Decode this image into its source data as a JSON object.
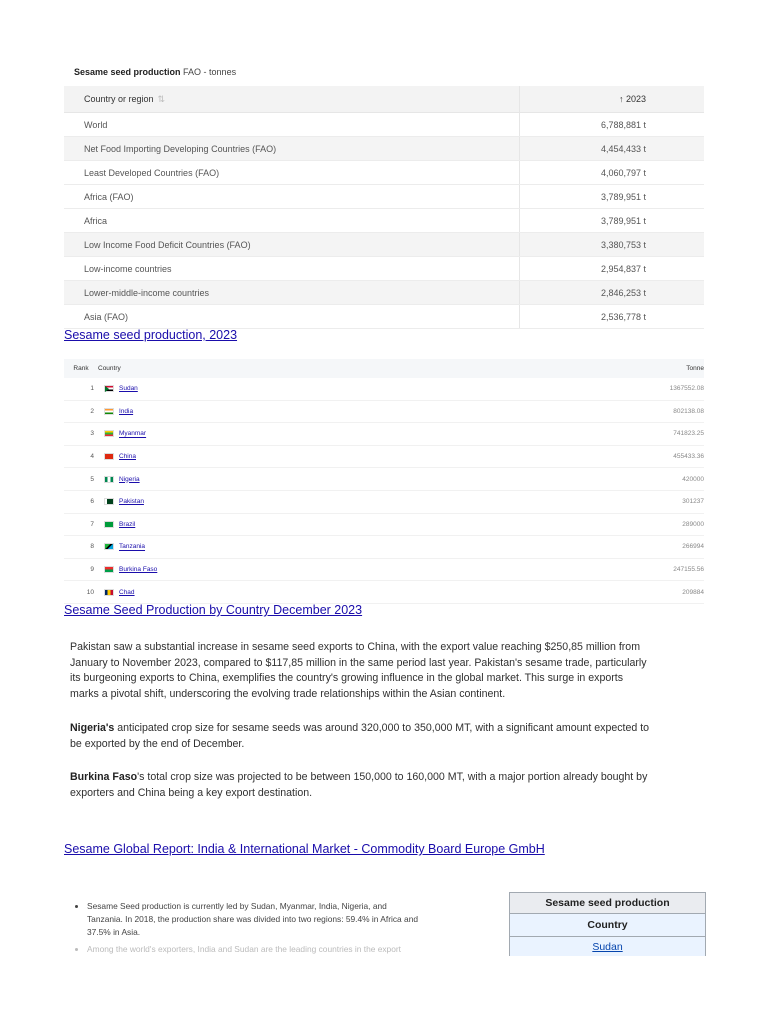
{
  "fao": {
    "caption_bold": "Sesame seed production",
    "caption_rest": " FAO - tonnes",
    "col_country": "Country or region",
    "sort_icon": "⇅",
    "col_year": "↑ 2023",
    "rows": [
      {
        "name": "World",
        "value": "6,788,881 t"
      },
      {
        "name": "Net Food Importing Developing Countries (FAO)",
        "value": "4,454,433 t"
      },
      {
        "name": "Least Developed Countries (FAO)",
        "value": "4,060,797 t"
      },
      {
        "name": "Africa (FAO)",
        "value": "3,789,951 t"
      },
      {
        "name": "Africa",
        "value": "3,789,951 t"
      },
      {
        "name": "Low Income Food Deficit Countries (FAO)",
        "value": "3,380,753 t"
      },
      {
        "name": "Low-income countries",
        "value": "2,954,837 t"
      },
      {
        "name": "Lower-middle-income countries",
        "value": "2,846,253 t"
      },
      {
        "name": "Asia (FAO)",
        "value": "2,536,778 t"
      }
    ]
  },
  "links": {
    "production_2023": "Sesame seed production, 2023",
    "by_country_dec_2023": "Sesame Seed Production by Country December 2023",
    "global_report": "Sesame Global Report: India & International Market - Commodity Board Europe GmbH"
  },
  "rank_table": {
    "col_rank": "Rank",
    "col_country": "Country",
    "col_value": "Tonne",
    "rows": [
      {
        "rank": "1",
        "country": "Sudan",
        "value": "1367552.08"
      },
      {
        "rank": "2",
        "country": "India",
        "value": "802138.08"
      },
      {
        "rank": "3",
        "country": "Myanmar",
        "value": "741823.25"
      },
      {
        "rank": "4",
        "country": "China",
        "value": "455433.36"
      },
      {
        "rank": "5",
        "country": "Nigeria",
        "value": "420000"
      },
      {
        "rank": "6",
        "country": "Pakistan",
        "value": "301237"
      },
      {
        "rank": "7",
        "country": "Brazil",
        "value": "289000"
      },
      {
        "rank": "8",
        "country": "Tanzania",
        "value": "266994"
      },
      {
        "rank": "9",
        "country": "Burkina Faso",
        "value": "247155.56"
      },
      {
        "rank": "10",
        "country": "Chad",
        "value": "209884"
      }
    ]
  },
  "article": {
    "p1": "Pakistan saw a substantial increase in sesame seed exports to China, with the export value reaching $250,85 million from January to November 2023, compared to $117,85 million in the same period last year. Pakistan's sesame trade, particularly its burgeoning exports to China, exemplifies the country's growing influence in the global market. This surge in exports marks a pivotal shift, underscoring the evolving trade relationships within the Asian continent.",
    "p2_bold": "Nigeria's",
    "p2_rest": " anticipated crop size for sesame seeds was around 320,000 to 350,000 MT, with a significant amount expected to be exported by the end of December.",
    "p3_bold": "Burkina Faso",
    "p3_rest": "'s total crop size was projected to be between 150,000 to 160,000 MT, with a major portion already bought by exporters and China being a key export destination."
  },
  "bullet": {
    "item1": "Sesame Seed production is currently led by Sudan, Myanmar, India, Nigeria, and Tanzania. In 2018, the production share was divided into two regions: 59.4% in Africa and 37.5% in Asia.",
    "item2": "Among the world's exporters, India and Sudan are the leading countries in the export trade."
  },
  "wiki": {
    "title": "Sesame seed production",
    "col_country": "Country",
    "first_row": "Sudan"
  }
}
